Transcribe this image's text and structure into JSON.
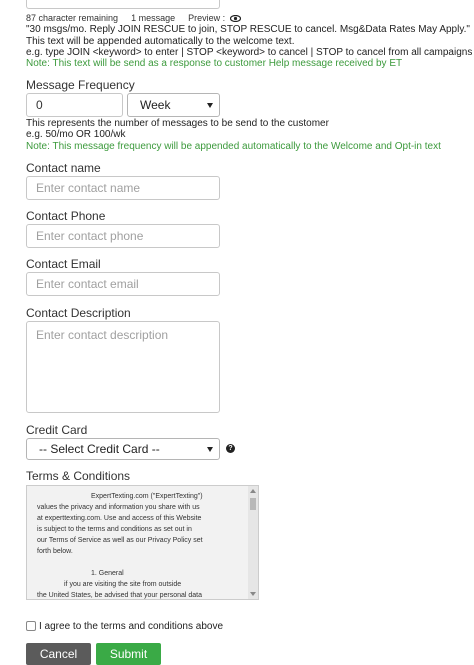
{
  "message_info": {
    "remaining": "87 character remaining",
    "count": "1 message",
    "preview_label": "Preview :",
    "preview_text": "\"30 msgs/mo. Reply JOIN RESCUE to join, STOP RESCUE to cancel. Msg&Data Rates May Apply.\"",
    "welcome_note": "This text will be appended automatically to the welcome text.",
    "example": "e.g. type JOIN <keyword> to enter | STOP <keyword> to cancel | STOP to cancel from all campaigns",
    "help_note": "Note: This text will be send as a response to customer Help message received by ET"
  },
  "frequency": {
    "label": "Message Frequency",
    "value": "0",
    "period": "Week",
    "help": "This represents the number of messages to be send to the customer",
    "example": "e.g. 50/mo OR 100/wk",
    "note": "Note: This message frequency will be appended automatically to the Welcome and Opt-in text"
  },
  "contact_name": {
    "label": "Contact name",
    "placeholder": "Enter contact name"
  },
  "contact_phone": {
    "label": "Contact Phone",
    "placeholder": "Enter contact phone"
  },
  "contact_email": {
    "label": "Contact Email",
    "placeholder": "Enter contact email"
  },
  "contact_description": {
    "label": "Contact Description",
    "placeholder": "Enter contact description"
  },
  "credit_card": {
    "label": "Credit Card",
    "selected": "-- Select Credit Card --",
    "help_symbol": "?"
  },
  "terms": {
    "label": "Terms & Conditions",
    "p1a": "ExpertTexting.com (\"ExpertTexting\")",
    "p1b": "values the privacy and information you share with us",
    "p1c": "at experttexting.com. Use and access of this Website",
    "p1d": "is subject to the terms and conditions as set out in",
    "p1e": "our Terms of Service as well as our Privacy Policy set",
    "p1f": "forth below.",
    "p2a": "1. General",
    "p2b": "if you are visiting the site from outside",
    "p2c": "the United States, be advised that your personal data"
  },
  "agree": {
    "label": "I agree to the terms and conditions above"
  },
  "buttons": {
    "cancel": "Cancel",
    "submit": "Submit"
  },
  "colors": {
    "note_green": "#3c9a3c",
    "cancel_bg": "#5b5b5b",
    "submit_bg": "#3aaa46"
  }
}
